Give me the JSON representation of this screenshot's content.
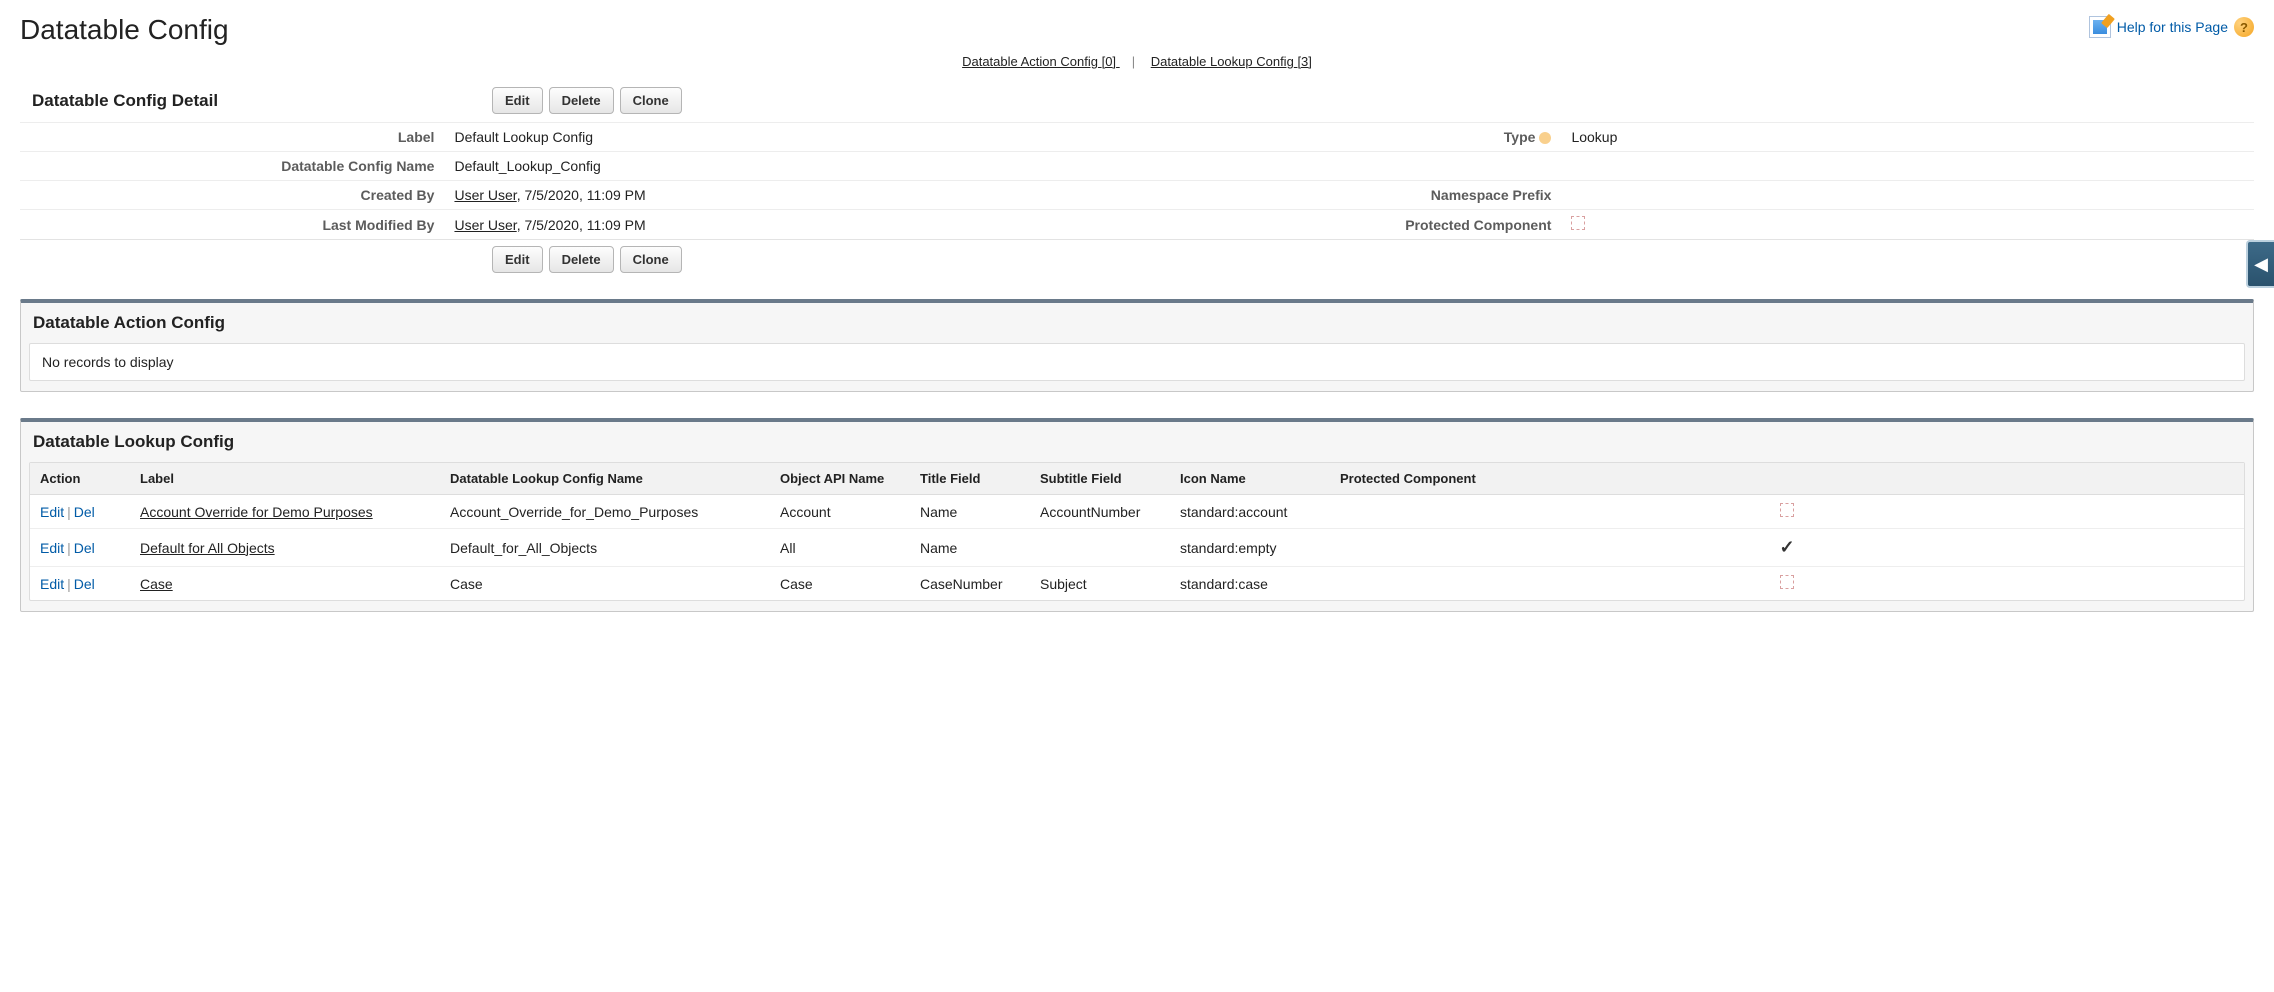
{
  "page_title": "Datatable Config",
  "help_label": "Help for this Page",
  "anchor_links": {
    "action": {
      "label": "Datatable Action Config",
      "count": "[0]"
    },
    "lookup": {
      "label": "Datatable Lookup Config",
      "count": "[3]"
    }
  },
  "detail": {
    "heading": "Datatable Config Detail",
    "buttons": {
      "edit": "Edit",
      "delete": "Delete",
      "clone": "Clone"
    },
    "fields": {
      "label_lbl": "Label",
      "label_val": "Default Lookup Config",
      "type_lbl": "Type",
      "type_val": "Lookup",
      "name_lbl": "Datatable Config Name",
      "name_val": "Default_Lookup_Config",
      "created_lbl": "Created By",
      "created_user": "User User",
      "created_ts": ", 7/5/2020, 11:09 PM",
      "ns_lbl": "Namespace Prefix",
      "ns_val": "",
      "modified_lbl": "Last Modified By",
      "modified_user": "User User",
      "modified_ts": ", 7/5/2020, 11:09 PM",
      "protected_lbl": "Protected Component"
    }
  },
  "related_action": {
    "heading": "Datatable Action Config",
    "empty": "No records to display"
  },
  "related_lookup": {
    "heading": "Datatable Lookup Config",
    "columns": {
      "action": "Action",
      "label": "Label",
      "name": "Datatable Lookup Config Name",
      "obj": "Object API Name",
      "title": "Title Field",
      "subtitle": "Subtitle Field",
      "icon": "Icon Name",
      "protected": "Protected Component"
    },
    "actions": {
      "edit": "Edit",
      "del": "Del"
    },
    "rows": [
      {
        "label": "Account Override for Demo Purposes",
        "name": "Account_Override_for_Demo_Purposes",
        "obj": "Account",
        "title": "Name",
        "subtitle": "AccountNumber",
        "icon": "standard:account",
        "protected": false
      },
      {
        "label": "Default for All Objects",
        "name": "Default_for_All_Objects",
        "obj": "All",
        "title": "Name",
        "subtitle": "",
        "icon": "standard:empty",
        "protected": true
      },
      {
        "label": "Case",
        "name": "Case",
        "obj": "Case",
        "title": "CaseNumber",
        "subtitle": "Subject",
        "icon": "standard:case",
        "protected": false
      }
    ]
  }
}
